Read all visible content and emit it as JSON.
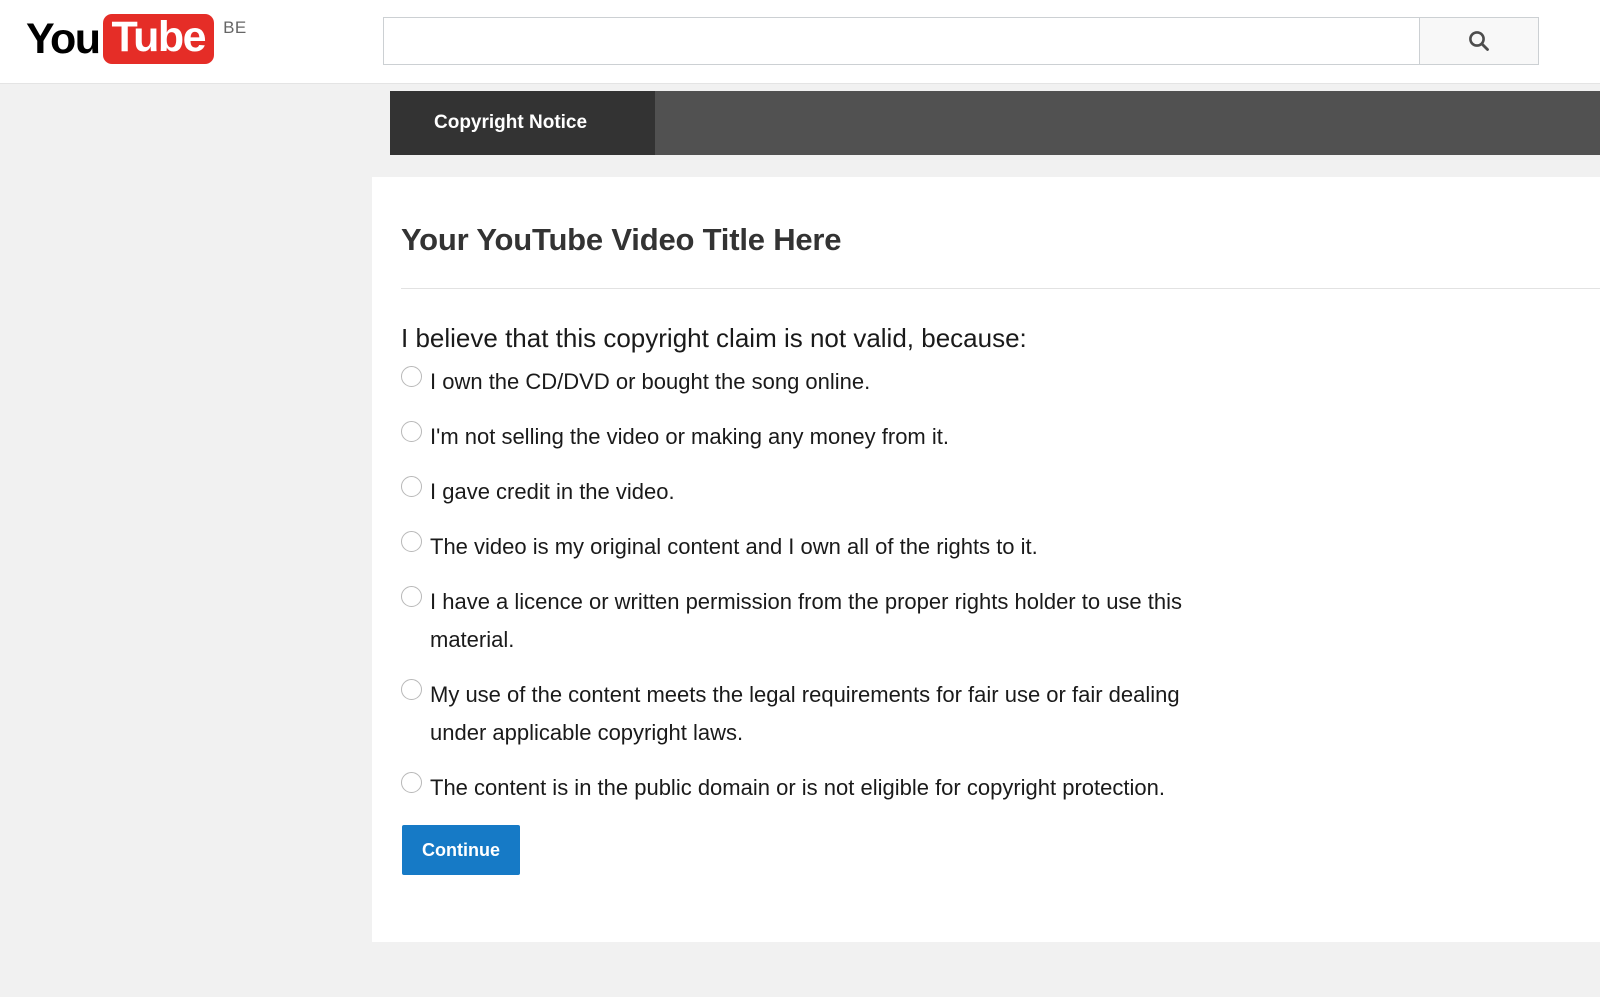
{
  "header": {
    "logo": {
      "you_text": "You",
      "tube_text": "Tube",
      "country_code": "BE"
    },
    "search": {
      "value": "",
      "placeholder": "",
      "icon": "search-icon",
      "button_title": "Search"
    }
  },
  "tabs": [
    {
      "label": "Copyright Notice",
      "active": true
    }
  ],
  "panel": {
    "video_title": "Your YouTube Video Title Here",
    "question": "I believe that this copyright claim is not valid, because:",
    "options": [
      {
        "label": "I own the CD/DVD or bought the song online.",
        "selected": false
      },
      {
        "label": "I'm not selling the video or making any money from it.",
        "selected": false
      },
      {
        "label": "I gave credit in the video.",
        "selected": false
      },
      {
        "label": "The video is my original content and I own all of the rights to it.",
        "selected": false
      },
      {
        "label": "I have a licence or written permission from the proper rights holder to use this material.",
        "selected": false
      },
      {
        "label": "My use of the content meets the legal requirements for fair use or fair dealing under applicable copyright laws.",
        "selected": false
      },
      {
        "label": "The content is in the public domain or is not eligible for copyright protection.",
        "selected": false
      }
    ],
    "continue_label": "Continue"
  },
  "colors": {
    "brand_red": "#e52d27",
    "tab_active_bg": "#333333",
    "tab_bar_bg": "#515151",
    "page_bg": "#f1f1f1",
    "button_blue": "#167ac6"
  }
}
